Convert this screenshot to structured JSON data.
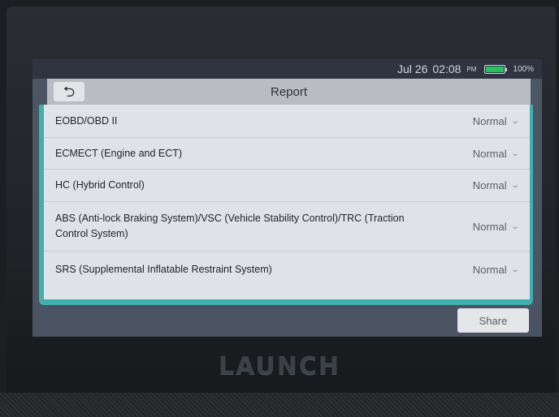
{
  "status_bar": {
    "date": "Jul 26",
    "time": "02:08",
    "time_suffix": "PM",
    "battery_percent": "100%",
    "battery_color": "#21c55d"
  },
  "header": {
    "back_icon": "back-arrow-icon",
    "title": "Report"
  },
  "rows": [
    {
      "label": "EOBD/OBD II",
      "value": "Normal"
    },
    {
      "label": "ECMECT (Engine and ECT)",
      "value": "Normal"
    },
    {
      "label": "HC (Hybrid Control)",
      "value": "Normal"
    },
    {
      "label": "ABS (Anti-lock Braking System)/VSC (Vehicle Stability Control)/TRC (Traction Control System)",
      "value": "Normal"
    },
    {
      "label": "SRS (Supplemental Inflatable Restraint System)",
      "value": "Normal"
    }
  ],
  "footer": {
    "share_label": "Share"
  },
  "device": {
    "brand": "LAUNCH"
  },
  "colors": {
    "accent_teal": "#3fb0ad"
  }
}
